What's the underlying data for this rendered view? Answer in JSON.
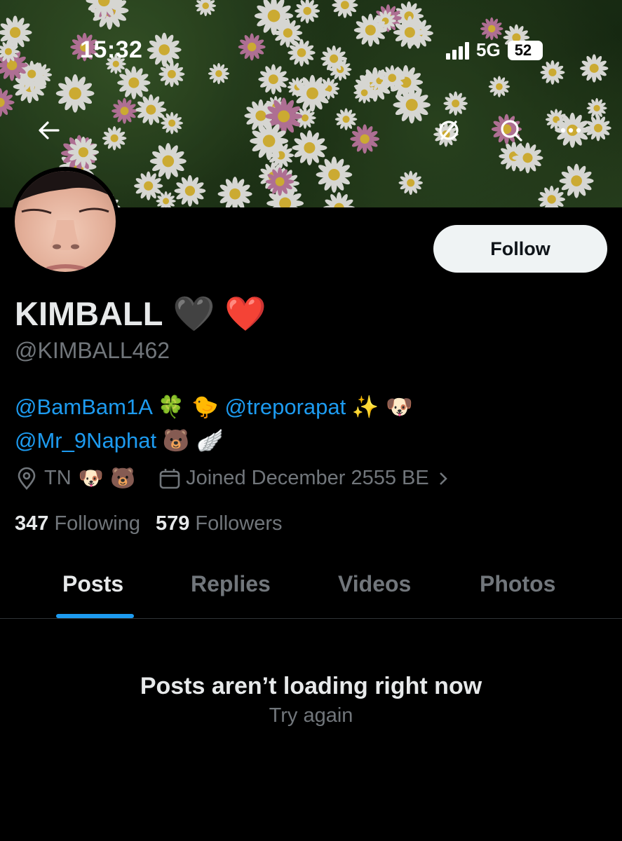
{
  "status_bar": {
    "time": "15:32",
    "network": "5G",
    "battery": "52"
  },
  "header": {
    "back_icon": "arrow-left-icon",
    "actions": [
      "mute-icon",
      "search-icon",
      "more-icon"
    ]
  },
  "profile": {
    "display_name": "KIMBALL",
    "name_emojis": [
      "🖤",
      "❤️"
    ],
    "handle": "@KIMBALL462",
    "follow_label": "Follow",
    "bio": {
      "line1": [
        {
          "type": "mention",
          "text": "@BamBam1A"
        },
        {
          "type": "emoji",
          "text": "🍀 🐤"
        },
        {
          "type": "mention",
          "text": "@treporapat"
        },
        {
          "type": "emoji",
          "text": "✨ 🐶"
        }
      ],
      "line2": [
        {
          "type": "mention",
          "text": "@Mr_9Naphat"
        },
        {
          "type": "emoji",
          "text": "🐻 🪽"
        }
      ]
    },
    "location": "TN",
    "location_emojis": "🐶 🐻",
    "joined": "Joined December 2555 BE",
    "following_count": "347",
    "following_label": "Following",
    "followers_count": "579",
    "followers_label": "Followers"
  },
  "tabs": [
    {
      "label": "Posts",
      "active": true
    },
    {
      "label": "Replies",
      "active": false
    },
    {
      "label": "Videos",
      "active": false
    },
    {
      "label": "Photos",
      "active": false
    }
  ],
  "empty_state": {
    "title": "Posts aren’t loading right now",
    "retry_label": "Try again"
  },
  "colors": {
    "accent": "#1d9bf0",
    "background": "#000000",
    "secondary_text": "#71767b"
  }
}
